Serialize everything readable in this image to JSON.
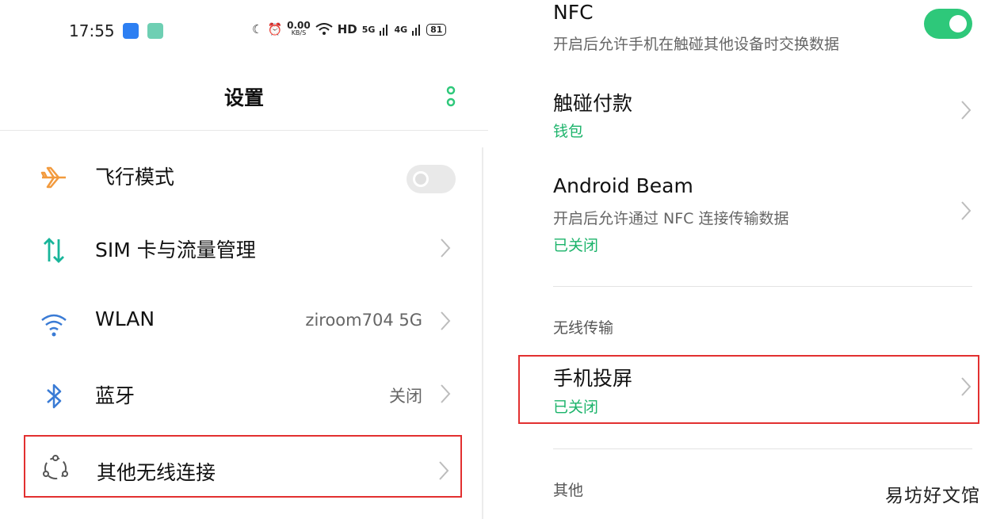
{
  "status_bar": {
    "time": "17:55",
    "net_speed": "0.00",
    "net_unit": "KB/S",
    "hd_label": "HD",
    "sig1": "5G",
    "sig2": "4G",
    "battery": "81"
  },
  "left": {
    "title": "设置",
    "items": [
      {
        "label": "飞行模式",
        "icon": "airplane-icon",
        "control": "toggle-off"
      },
      {
        "label": "SIM 卡与流量管理",
        "icon": "sim-data-icon",
        "control": "chevron"
      },
      {
        "label": "WLAN",
        "value": "ziroom704 5G",
        "icon": "wifi-icon",
        "control": "chevron"
      },
      {
        "label": "蓝牙",
        "value": "关闭",
        "icon": "bluetooth-icon",
        "control": "chevron"
      },
      {
        "label": "其他无线连接",
        "icon": "wireless-connections-icon",
        "control": "chevron",
        "highlighted": true
      }
    ]
  },
  "right": {
    "nfc": {
      "title": "NFC",
      "subtitle": "开启后允许手机在触碰其他设备时交换数据",
      "enabled": true
    },
    "tap_pay": {
      "title": "触碰付款",
      "value": "钱包"
    },
    "beam": {
      "title": "Android Beam",
      "subtitle": "开启后允许通过 NFC 连接传输数据",
      "value": "已关闭"
    },
    "section_wireless": "无线传输",
    "cast": {
      "title": "手机投屏",
      "value": "已关闭",
      "highlighted": true
    },
    "section_other": "其他"
  },
  "watermark": "易坊好文馆",
  "colors": {
    "accent_green": "#2ec87a",
    "status_green": "#1bb36a",
    "highlight_red": "#e23030",
    "icon_orange": "#f29a3d",
    "icon_blue": "#3a7bd5",
    "icon_teal": "#18b59a"
  }
}
